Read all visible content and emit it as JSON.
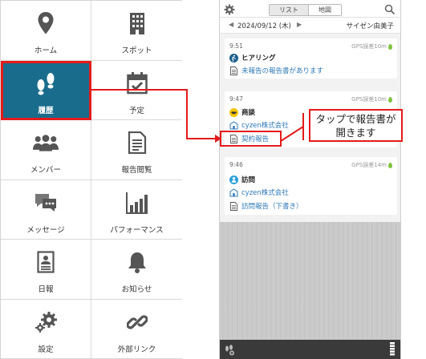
{
  "menu": {
    "items": [
      {
        "label": "ホーム",
        "icon": "map-pin-icon",
        "selected": false
      },
      {
        "label": "スポット",
        "icon": "building-icon",
        "selected": false
      },
      {
        "label": "履歴",
        "icon": "footprints-icon",
        "selected": true
      },
      {
        "label": "予定",
        "icon": "calendar-check-icon",
        "selected": false
      },
      {
        "label": "メンバー",
        "icon": "people-icon",
        "selected": false
      },
      {
        "label": "報告閲覧",
        "icon": "document-icon",
        "selected": false
      },
      {
        "label": "メッセージ",
        "icon": "chat-bubbles-icon",
        "selected": false
      },
      {
        "label": "パフォーマンス",
        "icon": "bar-chart-icon",
        "selected": false
      },
      {
        "label": "日報",
        "icon": "daily-report-icon",
        "selected": false
      },
      {
        "label": "お知らせ",
        "icon": "bell-icon",
        "selected": false
      },
      {
        "label": "設定",
        "icon": "gears-icon",
        "selected": false
      },
      {
        "label": "外部リンク",
        "icon": "chain-link-icon",
        "selected": false
      }
    ]
  },
  "phone": {
    "tabs": {
      "list": "リスト",
      "map": "地図",
      "active": "list"
    },
    "date": "2024/09/12 (木)",
    "prev_arrow": "◀",
    "next_arrow": "▶",
    "user": "サイゼン由美子",
    "cards": [
      {
        "time": "9:51",
        "gps": "GPS誤差10m",
        "title": "ヒアリング",
        "title_icon": "walking-person-icon",
        "company": "",
        "report": "未報告の報告書があります"
      },
      {
        "time": "9:47",
        "gps": "GPS誤差10m",
        "title": "商談",
        "title_icon": "handshake-icon",
        "company": "cyzen株式会社",
        "report": "契約報告"
      },
      {
        "time": "9:46",
        "gps": "GPS誤差14m",
        "title": "訪問",
        "title_icon": "visitor-icon",
        "company": "cyzen株式会社",
        "report": "訪問報告（下書き）"
      }
    ]
  },
  "callout": {
    "line1": "タップで報告書が",
    "line2": "開きます"
  },
  "colors": {
    "accent": "#1a6c8c",
    "highlight": "#e31b1b",
    "link": "#2f79b8",
    "gps_pin": "#7ec440"
  }
}
